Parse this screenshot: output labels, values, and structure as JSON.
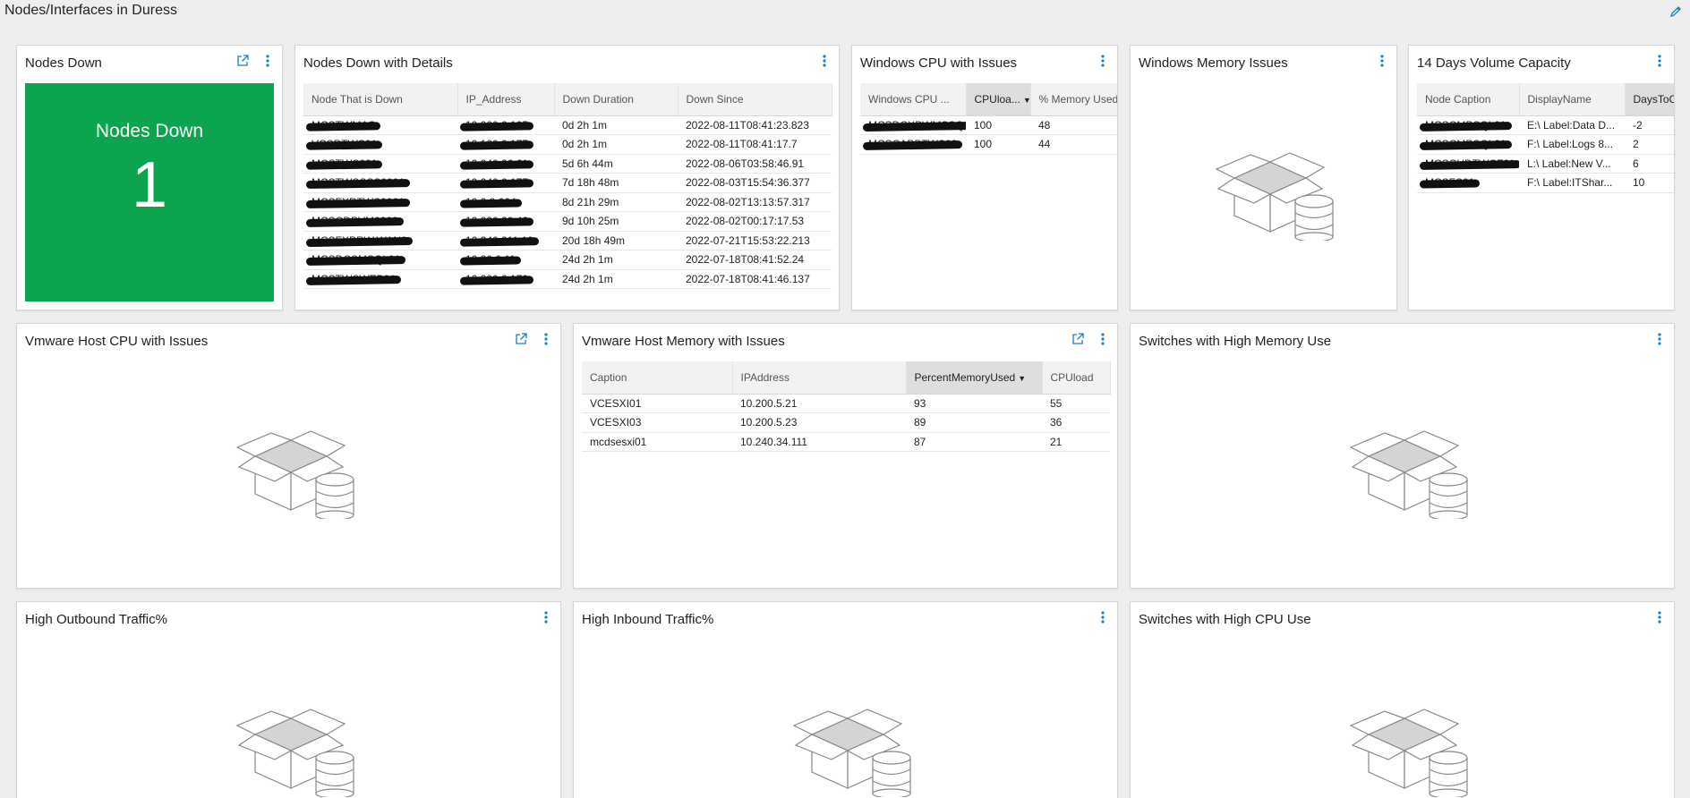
{
  "page": {
    "title": "Nodes/Interfaces in Duress"
  },
  "widgets": {
    "nodes_down": {
      "title": "Nodes Down",
      "tile_label": "Nodes Down",
      "tile_value": "1",
      "tile_color": "#0aa54e"
    },
    "nodes_down_details": {
      "title": "Nodes Down with Details",
      "columns": [
        "Node That is Down",
        "IP_Address",
        "Down Duration",
        "Down Since"
      ],
      "rows": [
        [
          "MCSTWMAS",
          "10.200.2.105",
          "0d 2h 1m",
          "2022-08-11T08:41:23.823"
        ],
        [
          "VCSRTWS01",
          "10.100.2.177",
          "0d 2h 1m",
          "2022-08-11T08:41:17.7"
        ],
        [
          "MCSTWS001",
          "10.240.26.61",
          "5d 6h 44m",
          "2022-08-06T03:58:46.91"
        ],
        [
          "MCSTWSSSS0001",
          "10.240.2.177",
          "7d 18h 48m",
          "2022-08-03T15:54:36.377"
        ],
        [
          "MCSFXRTWS0001",
          "10.0.3.204",
          "8d 21h 29m",
          "2022-08-02T13:13:57.317"
        ],
        [
          "MCSCDPVM0000",
          "10.220.20.42",
          "9d 10h 25m",
          "2022-08-02T00:17:17.53"
        ],
        [
          "MCSFXPRW.WAN2",
          "10.240.211.10",
          "20d 18h 49m",
          "2022-07-21T15:53:22.213"
        ],
        [
          "MCSDCSMSQL01",
          "10.20.0.11",
          "24d 2h 1m",
          "2022-07-18T08:41:52.24"
        ],
        [
          "MCSTWSWEB01",
          "10.200.2.179",
          "24d 2h 1m",
          "2022-07-18T08:41:46.137"
        ]
      ]
    },
    "windows_cpu": {
      "title": "Windows CPU with Issues",
      "columns": [
        "Windows CPU ...",
        "CPUloa...",
        "% Memory Used"
      ],
      "rows": [
        [
          "MCSDCXPWMSSQ1",
          "100",
          "48"
        ],
        [
          "MCSCAPPTWS02",
          "100",
          "44"
        ]
      ]
    },
    "windows_memory": {
      "title": "Windows Memory Issues"
    },
    "volume_capacity": {
      "title": "14 Days Volume Capacity",
      "columns": [
        "Node Caption",
        "DisplayName",
        "DaysToC"
      ],
      "rows": [
        [
          "MCSCMPSQL01",
          "E:\\ Label:Data D...",
          "-2"
        ],
        [
          "MCSCMPSQL01",
          "F:\\ Label:Logs 8...",
          "2"
        ],
        [
          "MCSCHDTWCF01",
          "L:\\ Label:New V...",
          "6"
        ],
        [
          "MCSFS01",
          "F:\\ Label:ITShar...",
          "10"
        ]
      ]
    },
    "vmware_cpu": {
      "title": "Vmware Host CPU with Issues"
    },
    "vmware_memory": {
      "title": "Vmware Host Memory with Issues",
      "columns": [
        "Caption",
        "IPAddress",
        "PercentMemoryUsed",
        "CPUload"
      ],
      "rows": [
        [
          "VCESXI01",
          "10.200.5.21",
          "93",
          "55"
        ],
        [
          "VCESXI03",
          "10.200.5.23",
          "89",
          "36"
        ],
        [
          "mcdsesxi01",
          "10.240.34.111",
          "87",
          "21"
        ]
      ]
    },
    "switches_memory": {
      "title": "Switches with High Memory Use"
    },
    "outbound": {
      "title": "High Outbound Traffic%"
    },
    "inbound": {
      "title": "High Inbound Traffic%"
    },
    "switches_cpu": {
      "title": "Switches with High CPU Use"
    }
  },
  "icons": {
    "popout": "popout-icon",
    "menu": "kebab-menu-icon",
    "edit": "pencil-icon",
    "empty": "empty-box-database-icon"
  },
  "colors": {
    "accent": "#1a7fc1"
  }
}
